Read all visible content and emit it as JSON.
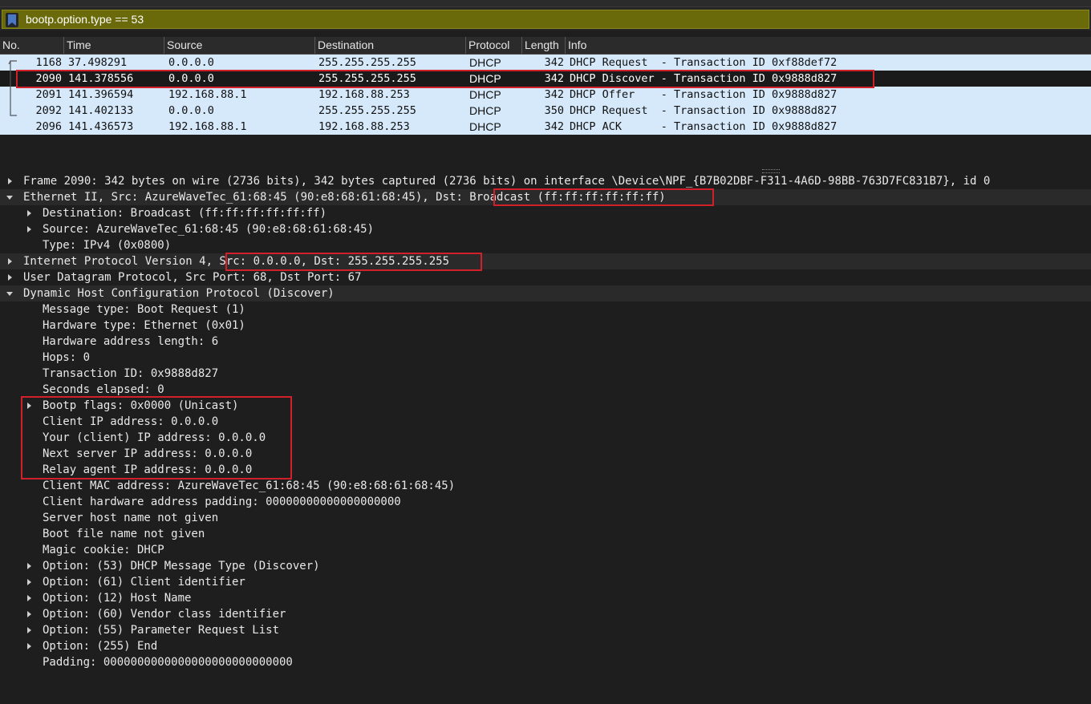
{
  "filter": {
    "value": "bootp.option.type == 53"
  },
  "columns": [
    "No.",
    "Time",
    "Source",
    "Destination",
    "Protocol",
    "Length",
    "Info"
  ],
  "packets": [
    {
      "no": "1168",
      "time": "37.498291",
      "src": "0.0.0.0",
      "dst": "255.255.255.255",
      "proto": "DHCP",
      "len": "342",
      "info": "DHCP Request  - Transaction ID 0xf88def72"
    },
    {
      "no": "2090",
      "time": "141.378556",
      "src": "0.0.0.0",
      "dst": "255.255.255.255",
      "proto": "DHCP",
      "len": "342",
      "info": "DHCP Discover - Transaction ID 0x9888d827"
    },
    {
      "no": "2091",
      "time": "141.396594",
      "src": "192.168.88.1",
      "dst": "192.168.88.253",
      "proto": "DHCP",
      "len": "342",
      "info": "DHCP Offer    - Transaction ID 0x9888d827"
    },
    {
      "no": "2092",
      "time": "141.402133",
      "src": "0.0.0.0",
      "dst": "255.255.255.255",
      "proto": "DHCP",
      "len": "350",
      "info": "DHCP Request  - Transaction ID 0x9888d827"
    },
    {
      "no": "2096",
      "time": "141.436573",
      "src": "192.168.88.1",
      "dst": "192.168.88.253",
      "proto": "DHCP",
      "len": "342",
      "info": "DHCP ACK      - Transaction ID 0x9888d827"
    }
  ],
  "selected_packet_index": 1,
  "details": [
    {
      "text": "Frame 2090: 342 bytes on wire (2736 bits), 342 bytes captured (2736 bits) on interface \\Device\\NPF_{B7B02DBF-F311-4A6D-98BB-763D7FC831B7}, id 0",
      "indent": 0,
      "expander": "collapsed"
    },
    {
      "text": "Ethernet II, Src: AzureWaveTec_61:68:45 (90:e8:68:61:68:45), Dst: Broadcast (ff:ff:ff:ff:ff:ff)",
      "indent": 0,
      "expander": "expanded"
    },
    {
      "text": "Destination: Broadcast (ff:ff:ff:ff:ff:ff)",
      "indent": 1,
      "expander": "collapsed"
    },
    {
      "text": "Source: AzureWaveTec_61:68:45 (90:e8:68:61:68:45)",
      "indent": 1,
      "expander": "collapsed"
    },
    {
      "text": "Type: IPv4 (0x0800)",
      "indent": 1,
      "expander": "none"
    },
    {
      "text": "Internet Protocol Version 4, Src: 0.0.0.0, Dst: 255.255.255.255",
      "indent": 0,
      "expander": "collapsed"
    },
    {
      "text": "User Datagram Protocol, Src Port: 68, Dst Port: 67",
      "indent": 0,
      "expander": "collapsed"
    },
    {
      "text": "Dynamic Host Configuration Protocol (Discover)",
      "indent": 0,
      "expander": "expanded"
    },
    {
      "text": "Message type: Boot Request (1)",
      "indent": 1,
      "expander": "none"
    },
    {
      "text": "Hardware type: Ethernet (0x01)",
      "indent": 1,
      "expander": "none"
    },
    {
      "text": "Hardware address length: 6",
      "indent": 1,
      "expander": "none"
    },
    {
      "text": "Hops: 0",
      "indent": 1,
      "expander": "none"
    },
    {
      "text": "Transaction ID: 0x9888d827",
      "indent": 1,
      "expander": "none"
    },
    {
      "text": "Seconds elapsed: 0",
      "indent": 1,
      "expander": "none"
    },
    {
      "text": "Bootp flags: 0x0000 (Unicast)",
      "indent": 1,
      "expander": "collapsed"
    },
    {
      "text": "Client IP address: 0.0.0.0",
      "indent": 1,
      "expander": "none"
    },
    {
      "text": "Your (client) IP address: 0.0.0.0",
      "indent": 1,
      "expander": "none"
    },
    {
      "text": "Next server IP address: 0.0.0.0",
      "indent": 1,
      "expander": "none"
    },
    {
      "text": "Relay agent IP address: 0.0.0.0",
      "indent": 1,
      "expander": "none"
    },
    {
      "text": "Client MAC address: AzureWaveTec_61:68:45 (90:e8:68:61:68:45)",
      "indent": 1,
      "expander": "none"
    },
    {
      "text": "Client hardware address padding: 00000000000000000000",
      "indent": 1,
      "expander": "none"
    },
    {
      "text": "Server host name not given",
      "indent": 1,
      "expander": "none"
    },
    {
      "text": "Boot file name not given",
      "indent": 1,
      "expander": "none"
    },
    {
      "text": "Magic cookie: DHCP",
      "indent": 1,
      "expander": "none"
    },
    {
      "text": "Option: (53) DHCP Message Type (Discover)",
      "indent": 1,
      "expander": "collapsed"
    },
    {
      "text": "Option: (61) Client identifier",
      "indent": 1,
      "expander": "collapsed"
    },
    {
      "text": "Option: (12) Host Name",
      "indent": 1,
      "expander": "collapsed"
    },
    {
      "text": "Option: (60) Vendor class identifier",
      "indent": 1,
      "expander": "collapsed"
    },
    {
      "text": "Option: (55) Parameter Request List",
      "indent": 1,
      "expander": "collapsed"
    },
    {
      "text": "Option: (255) End",
      "indent": 1,
      "expander": "collapsed"
    },
    {
      "text": "Padding: 0000000000000000000000000000",
      "indent": 1,
      "expander": "none"
    }
  ],
  "colors": {
    "filter_bg": "#6b6a0a",
    "list_bg": "#d6e9fb",
    "selected_bg": "#1a1a1a",
    "highlight": "#d2202a"
  }
}
